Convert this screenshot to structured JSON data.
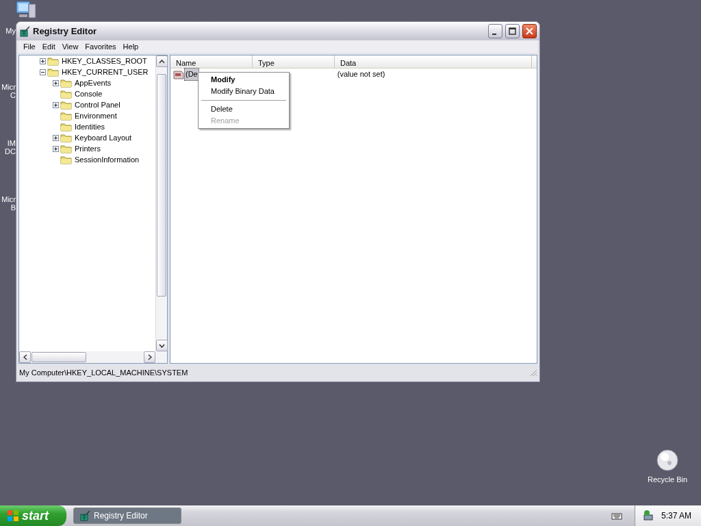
{
  "desktop": {
    "left_icons": [
      {
        "lines": [
          "My"
        ]
      },
      {
        "lines": [
          "Micr",
          "C"
        ]
      },
      {
        "lines": [
          "IM",
          "DC"
        ]
      },
      {
        "lines": [
          "Micr",
          "B"
        ]
      }
    ],
    "recycle_bin": {
      "label": "Recycle Bin"
    }
  },
  "window": {
    "title": "Registry Editor",
    "menu": [
      "File",
      "Edit",
      "View",
      "Favorites",
      "Help"
    ],
    "tree": [
      {
        "label": "HKEY_CLASSES_ROOT",
        "expanded": false
      },
      {
        "label": "HKEY_CURRENT_USER",
        "expanded": true,
        "children": [
          {
            "label": "AppEvents",
            "expanded": false
          },
          {
            "label": "Console"
          },
          {
            "label": "Control Panel",
            "expanded": false
          },
          {
            "label": "Environment"
          },
          {
            "label": "Identities"
          },
          {
            "label": "Keyboard Layout",
            "expanded": false
          },
          {
            "label": "Printers",
            "expanded": false
          },
          {
            "label": "SessionInformation"
          }
        ]
      }
    ],
    "columns": [
      "Name",
      "Type",
      "Data"
    ],
    "values": [
      {
        "name": "(De",
        "data": "(value not set)",
        "selected": true
      }
    ],
    "context_menu": [
      {
        "kind": "item",
        "label": "Modify",
        "default": true,
        "disabled": false
      },
      {
        "kind": "item",
        "label": "Modify Binary Data",
        "default": false,
        "disabled": false
      },
      {
        "kind": "separator"
      },
      {
        "kind": "item",
        "label": "Delete",
        "default": false,
        "disabled": false
      },
      {
        "kind": "item",
        "label": "Rename",
        "default": false,
        "disabled": true
      }
    ],
    "status_bar": "My Computer\\HKEY_LOCAL_MACHINE\\SYSTEM"
  },
  "taskbar": {
    "start": "start",
    "tasks": [
      {
        "label": "Registry Editor",
        "selected": true
      }
    ],
    "clock": "5:37 AM"
  }
}
